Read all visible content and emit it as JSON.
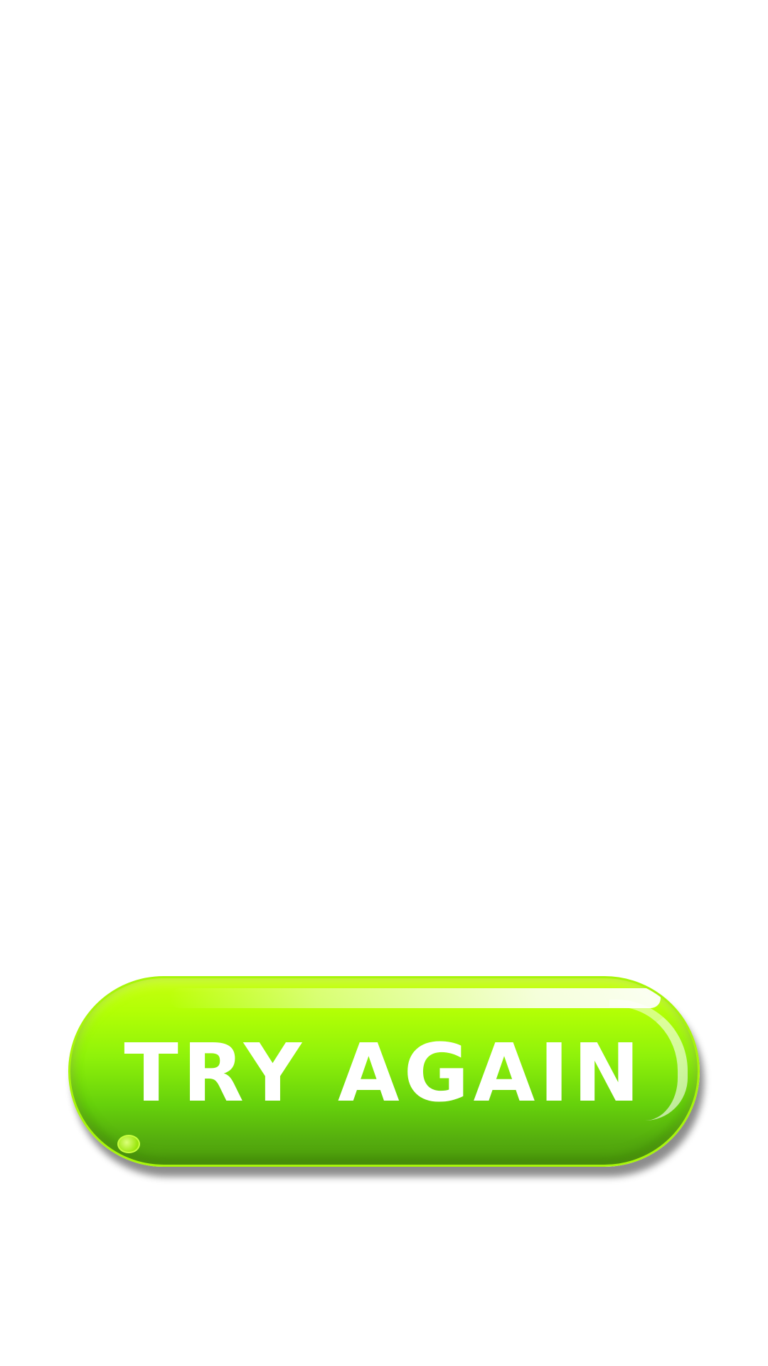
{
  "button": {
    "label": "TRY AGAIN"
  },
  "colors": {
    "background": "#ffffff",
    "button_top": "#c8ff10",
    "button_bottom": "#4fa10c",
    "label": "#ffffff"
  }
}
